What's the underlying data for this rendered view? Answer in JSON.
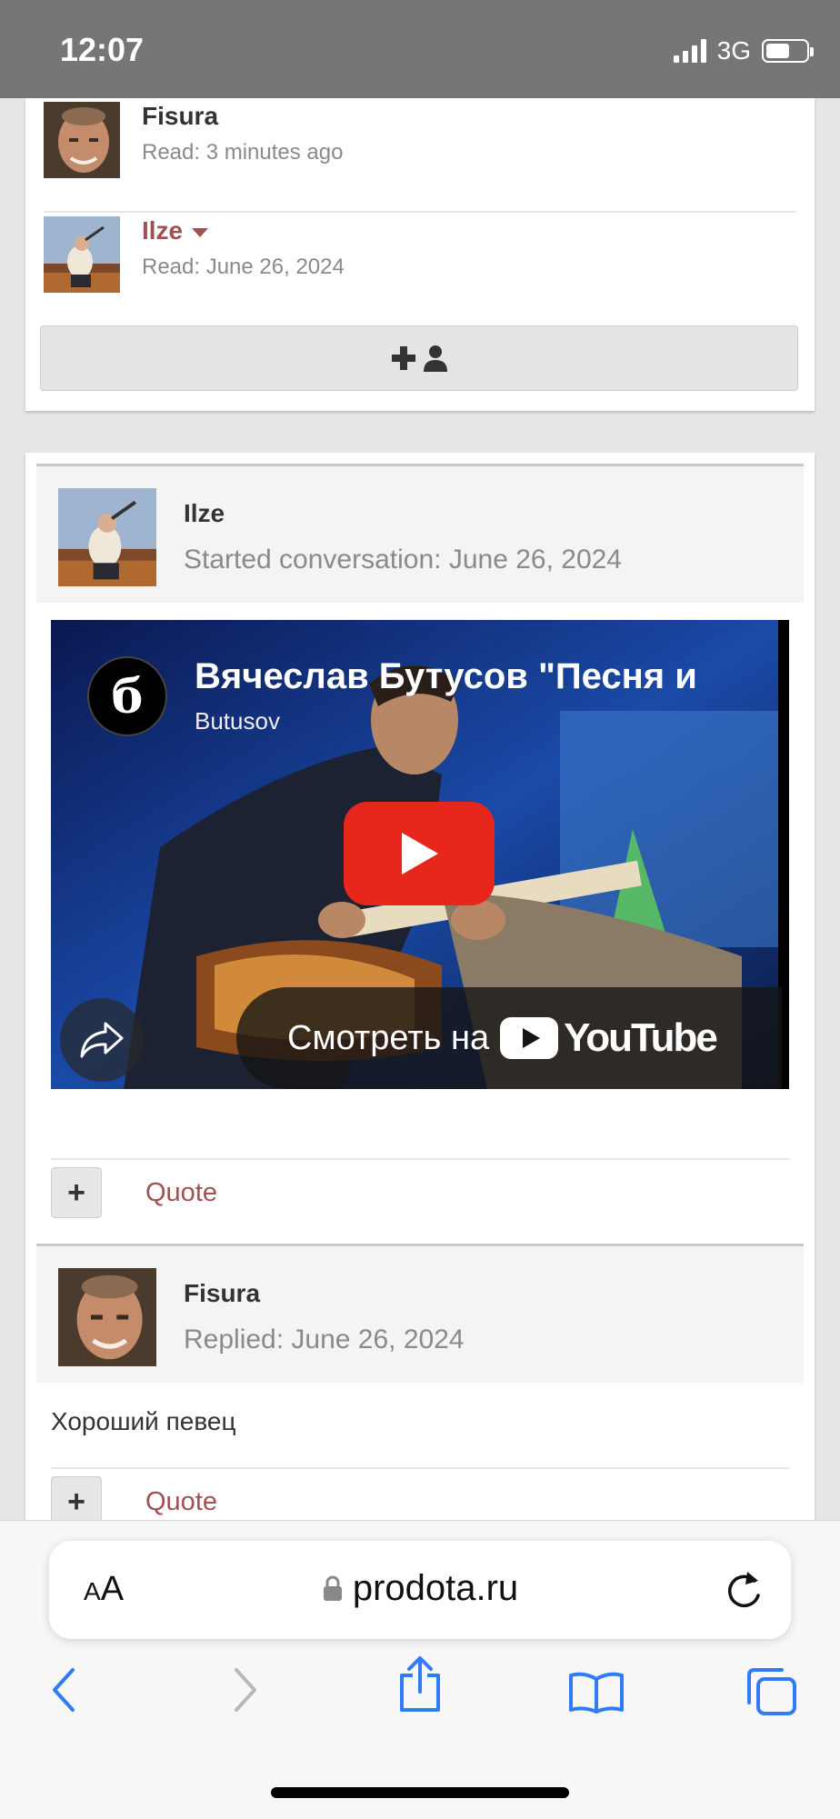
{
  "status_bar": {
    "time": "12:07",
    "network": "3G",
    "battery_level": 0.6
  },
  "participants": [
    {
      "name": "Fisura",
      "read": "Read: 3 minutes ago"
    },
    {
      "name": "Ilze",
      "read": "Read: June 26, 2024"
    }
  ],
  "conversation": {
    "first_post": {
      "author": "Ilze",
      "meta": "Started conversation: June 26, 2024",
      "video": {
        "title": "Вячеслав Бутусов \"Песня и",
        "channel": "Butusov",
        "channel_logo_glyph": "б",
        "watch_label": "Смотреть на",
        "youtube_word": "YouTube"
      },
      "quote_label": "Quote"
    },
    "reply": {
      "author": "Fisura",
      "meta": "Replied: June 26, 2024",
      "text": "Хороший певец",
      "quote_label": "Quote"
    }
  },
  "browser": {
    "aa_label_small": "A",
    "aa_label_large": "A",
    "url": "prodota.ru"
  },
  "colors": {
    "accent": "#a05151",
    "youtube_red": "#e8271c",
    "ios_blue": "#2f7cf6"
  }
}
